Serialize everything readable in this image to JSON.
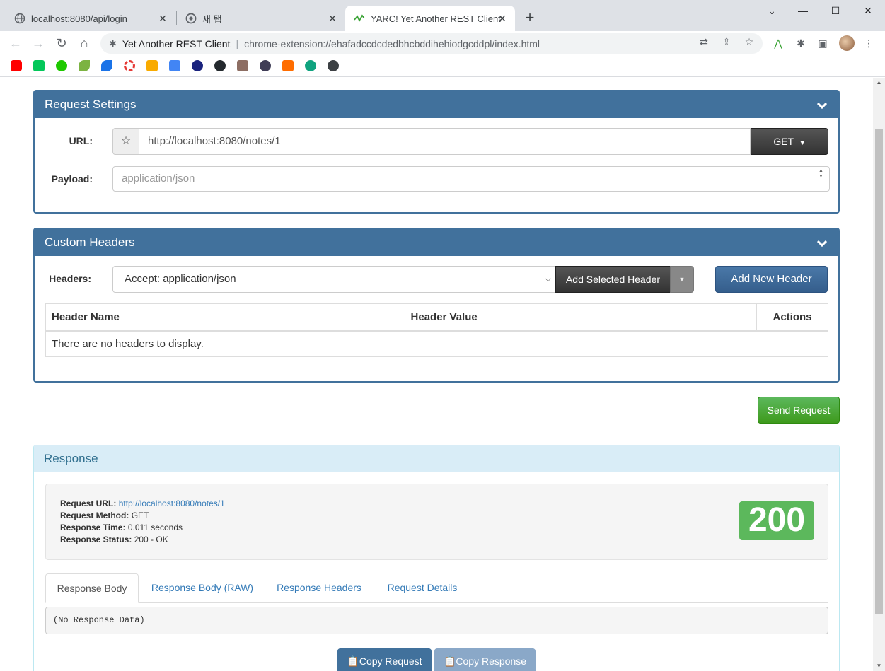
{
  "browser": {
    "tabs": [
      {
        "title": "localhost:8080/api/login"
      },
      {
        "title": "새 탭"
      },
      {
        "title": "YARC! Yet Another REST Client"
      }
    ],
    "omnibox": {
      "site_name": "Yet Another REST Client",
      "url": "chrome-extension://ehafadccdcdedbhcbddihehiodgcddpl/index.html"
    }
  },
  "request_settings": {
    "title": "Request Settings",
    "url_label": "URL:",
    "url_value": "http://localhost:8080/notes/1",
    "method": "GET",
    "payload_label": "Payload:",
    "payload_placeholder": "application/json"
  },
  "custom_headers": {
    "title": "Custom Headers",
    "headers_label": "Headers:",
    "selected_header": "Accept: application/json",
    "add_selected_label": "Add Selected Header",
    "add_new_label": "Add New Header",
    "columns": [
      "Header Name",
      "Header Value",
      "Actions"
    ],
    "empty_text": "There are no headers to display."
  },
  "send_request_label": "Send Request",
  "response": {
    "title": "Response",
    "request_url_label": "Request URL:",
    "request_url": "http://localhost:8080/notes/1",
    "request_method_label": "Request Method:",
    "request_method": "GET",
    "response_time_label": "Response Time:",
    "response_time": "0.011 seconds",
    "response_status_label": "Response Status:",
    "response_status": "200 - OK",
    "status_code": "200",
    "tabs": [
      "Response Body",
      "Response Body (RAW)",
      "Response Headers",
      "Request Details"
    ],
    "body_text": "(No Response Data)",
    "copy_request_label": "Copy Request",
    "copy_response_label": "Copy Response"
  },
  "colors": {
    "panel_primary": "#41719c",
    "status_success": "#5cb85c",
    "send_button": "#3e9a1c",
    "link": "#337ab7"
  }
}
